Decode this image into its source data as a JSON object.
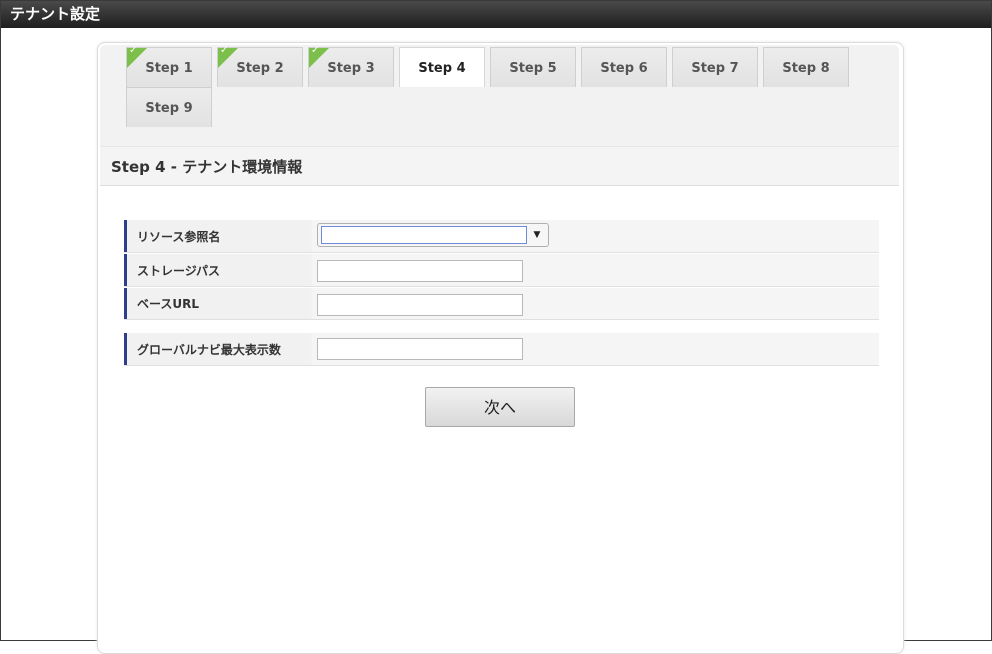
{
  "window": {
    "title": "テナント設定"
  },
  "steps": [
    {
      "label": "Step 1",
      "completed": true
    },
    {
      "label": "Step 2",
      "completed": true
    },
    {
      "label": "Step 3",
      "completed": true
    },
    {
      "label": "Step 4",
      "completed": false,
      "active": true
    },
    {
      "label": "Step 5",
      "completed": false
    },
    {
      "label": "Step 6",
      "completed": false
    },
    {
      "label": "Step 7",
      "completed": false
    },
    {
      "label": "Step 8",
      "completed": false
    },
    {
      "label": "Step 9",
      "completed": false
    }
  ],
  "section": {
    "title": "Step 4 - テナント環境情報"
  },
  "form": {
    "resource_ref_name": {
      "label": "リソース参照名",
      "value": ""
    },
    "storage_path": {
      "label": "ストレージパス",
      "value": ""
    },
    "base_url": {
      "label": "ベースURL",
      "value": ""
    },
    "global_nav_max": {
      "label": "グローバルナビ最大表示数",
      "value": ""
    }
  },
  "actions": {
    "next_label": "次へ"
  },
  "colors": {
    "check_green": "#7cc04b",
    "label_accent": "#2d3e8c",
    "title_bar": "#2a2a2a"
  }
}
